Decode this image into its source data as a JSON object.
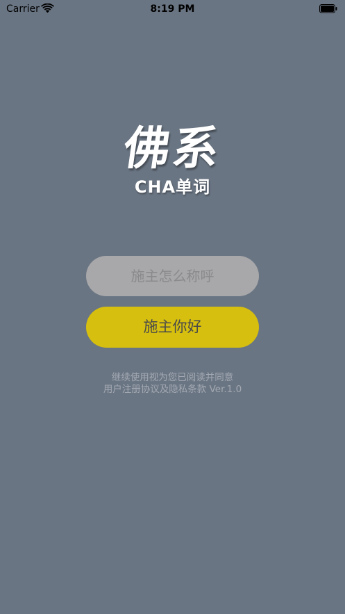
{
  "status_bar": {
    "carrier": "Carrier",
    "time": "8:19 PM",
    "icons": [
      "wifi-icon",
      "battery-icon"
    ]
  },
  "logo": {
    "title": "佛系",
    "subtitle": "CHA单词"
  },
  "name_input": {
    "placeholder": "施主怎么称呼",
    "value": ""
  },
  "hello_button": {
    "label": "施主你好"
  },
  "agreement": {
    "line1": "继续使用视为您已阅读并同意",
    "line2": "用户注册协议及隐私条款 Ver.1.0"
  },
  "colors": {
    "background": "#6a7583",
    "input_background": "#a8a8aa",
    "button_background": "#d6bf0e",
    "agreement_text": "#a3a9b3"
  }
}
